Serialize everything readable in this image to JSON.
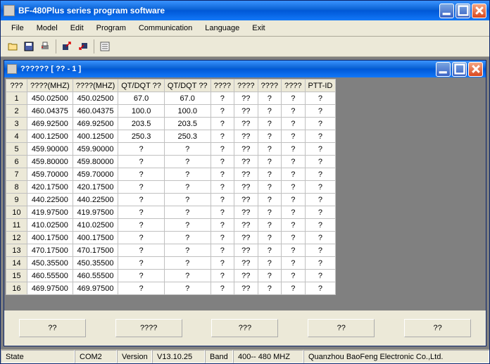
{
  "app_title": "BF-480Plus series program software",
  "menu": [
    "File",
    "Model",
    "Edit",
    "Program",
    "Communication",
    "Language",
    "Exit"
  ],
  "child_title": "?????? [ ??  -  1 ]",
  "columns": [
    "???",
    "????(MHZ)",
    "????(MHZ)",
    "QT/DQT ??",
    "QT/DQT ??",
    "????",
    "????",
    "????",
    "????",
    "PTT-ID"
  ],
  "rows": [
    [
      "1",
      "450.02500",
      "450.02500",
      "67.0",
      "67.0",
      "?",
      "??",
      "?",
      "?",
      "?"
    ],
    [
      "2",
      "460.04375",
      "460.04375",
      "100.0",
      "100.0",
      "?",
      "??",
      "?",
      "?",
      "?"
    ],
    [
      "3",
      "469.92500",
      "469.92500",
      "203.5",
      "203.5",
      "?",
      "??",
      "?",
      "?",
      "?"
    ],
    [
      "4",
      "400.12500",
      "400.12500",
      "250.3",
      "250.3",
      "?",
      "??",
      "?",
      "?",
      "?"
    ],
    [
      "5",
      "459.90000",
      "459.90000",
      "?",
      "?",
      "?",
      "??",
      "?",
      "?",
      "?"
    ],
    [
      "6",
      "459.80000",
      "459.80000",
      "?",
      "?",
      "?",
      "??",
      "?",
      "?",
      "?"
    ],
    [
      "7",
      "459.70000",
      "459.70000",
      "?",
      "?",
      "?",
      "??",
      "?",
      "?",
      "?"
    ],
    [
      "8",
      "420.17500",
      "420.17500",
      "?",
      "?",
      "?",
      "??",
      "?",
      "?",
      "?"
    ],
    [
      "9",
      "440.22500",
      "440.22500",
      "?",
      "?",
      "?",
      "??",
      "?",
      "?",
      "?"
    ],
    [
      "10",
      "419.97500",
      "419.97500",
      "?",
      "?",
      "?",
      "??",
      "?",
      "?",
      "?"
    ],
    [
      "11",
      "410.02500",
      "410.02500",
      "?",
      "?",
      "?",
      "??",
      "?",
      "?",
      "?"
    ],
    [
      "12",
      "400.17500",
      "400.17500",
      "?",
      "?",
      "?",
      "??",
      "?",
      "?",
      "?"
    ],
    [
      "13",
      "470.17500",
      "470.17500",
      "?",
      "?",
      "?",
      "??",
      "?",
      "?",
      "?"
    ],
    [
      "14",
      "450.35500",
      "450.35500",
      "?",
      "?",
      "?",
      "??",
      "?",
      "?",
      "?"
    ],
    [
      "15",
      "460.55500",
      "460.55500",
      "?",
      "?",
      "?",
      "??",
      "?",
      "?",
      "?"
    ],
    [
      "16",
      "469.97500",
      "469.97500",
      "?",
      "?",
      "?",
      "??",
      "?",
      "?",
      "?"
    ]
  ],
  "bottom_buttons": [
    "??",
    "????",
    "???",
    "??",
    "??"
  ],
  "status": {
    "state_label": "State",
    "com": "COM2",
    "version_label": "Version",
    "version": "V13.10.25",
    "band_label": "Band",
    "band": "400-- 480 MHZ",
    "company": "Quanzhou BaoFeng Electronic Co.,Ltd."
  }
}
